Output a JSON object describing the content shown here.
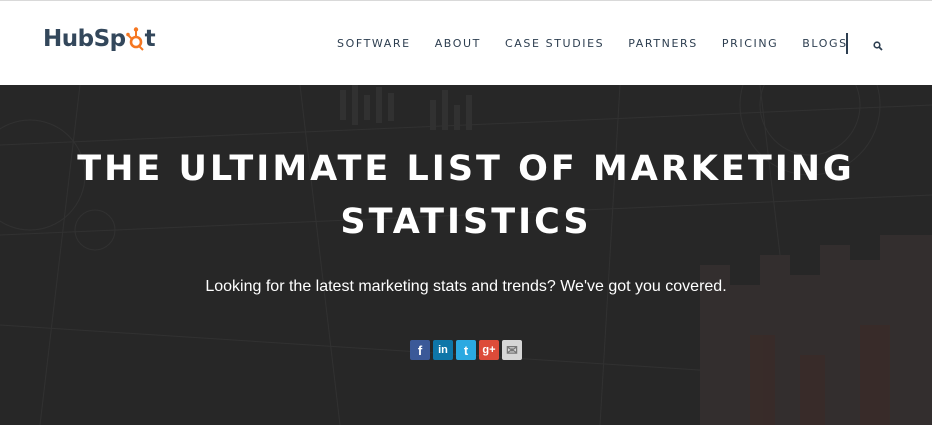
{
  "header": {
    "logo_text_a": "HubSp",
    "logo_text_b": "t",
    "nav": [
      {
        "label": "SOFTWARE"
      },
      {
        "label": "ABOUT"
      },
      {
        "label": "CASE STUDIES"
      },
      {
        "label": "PARTNERS"
      },
      {
        "label": "PRICING"
      },
      {
        "label": "BLOGS"
      }
    ],
    "search_icon": "search-icon"
  },
  "hero": {
    "title_line1": "THE ULTIMATE LIST OF MARKETING",
    "title_line2": "STATISTICS",
    "subtitle": "Looking for the latest marketing stats and trends? We've got you covered."
  },
  "share": [
    {
      "icon": "facebook-icon",
      "glyph": "f",
      "color": "#3b5998"
    },
    {
      "icon": "linkedin-icon",
      "glyph": "in",
      "color": "#0e76a8"
    },
    {
      "icon": "twitter-icon",
      "glyph": "t",
      "color": "#2ba9e1"
    },
    {
      "icon": "google-plus-icon",
      "glyph": "g+",
      "color": "#dd4b39"
    },
    {
      "icon": "email-icon",
      "glyph": "✉",
      "color": "#d6d6d6"
    }
  ],
  "colors": {
    "brand_orange": "#f57722",
    "nav_text": "#2d3e50",
    "hero_bg": "#2b2b2b"
  }
}
